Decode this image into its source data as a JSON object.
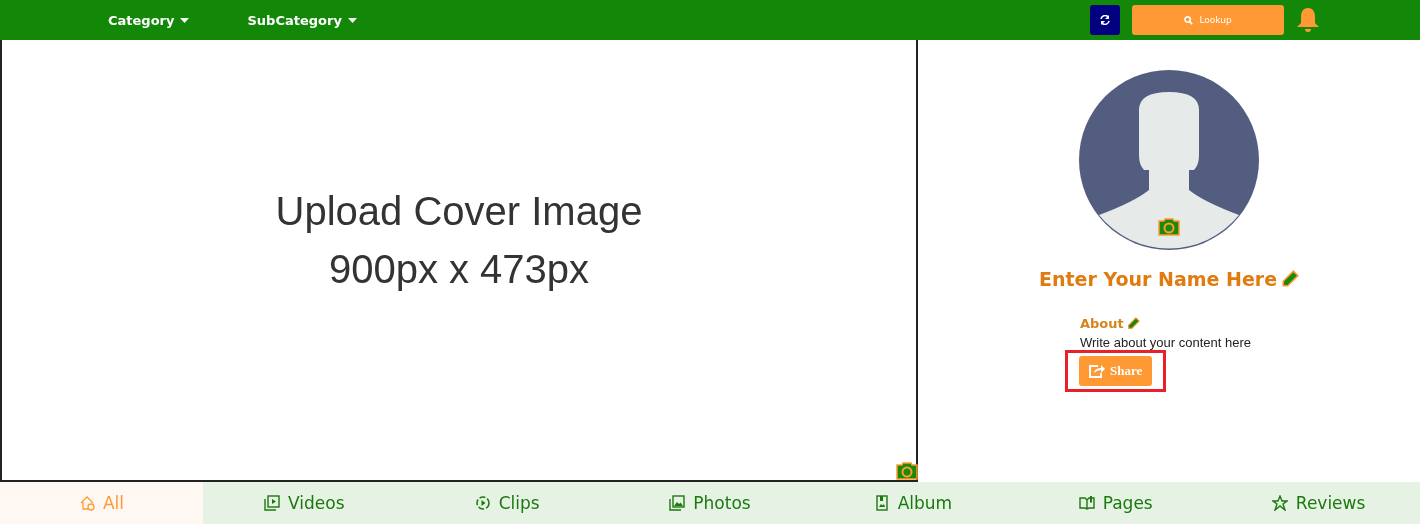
{
  "navbar": {
    "menus": [
      {
        "label": "Category"
      },
      {
        "label": "SubCategory"
      }
    ],
    "lookup_button": "Lookup"
  },
  "cover": {
    "lines": [
      "Upload Cover Image",
      "900px x 473px"
    ]
  },
  "profile": {
    "name": "Enter Your Name Here",
    "about_title": "About",
    "about_text": "Write about your content here",
    "share": {
      "label": "Share",
      "highlighted": true
    }
  },
  "tabs": [
    {
      "label": "All",
      "kind": "home",
      "selected": true
    },
    {
      "label": "Videos",
      "kind": "video",
      "selected": false
    },
    {
      "label": "Clips",
      "kind": "clip",
      "selected": false
    },
    {
      "label": "Photos",
      "kind": "photo",
      "selected": false
    },
    {
      "label": "Album",
      "kind": "album",
      "selected": false
    },
    {
      "label": "Pages",
      "kind": "book",
      "selected": false
    },
    {
      "label": "Reviews",
      "kind": "star",
      "selected": false
    }
  ]
}
